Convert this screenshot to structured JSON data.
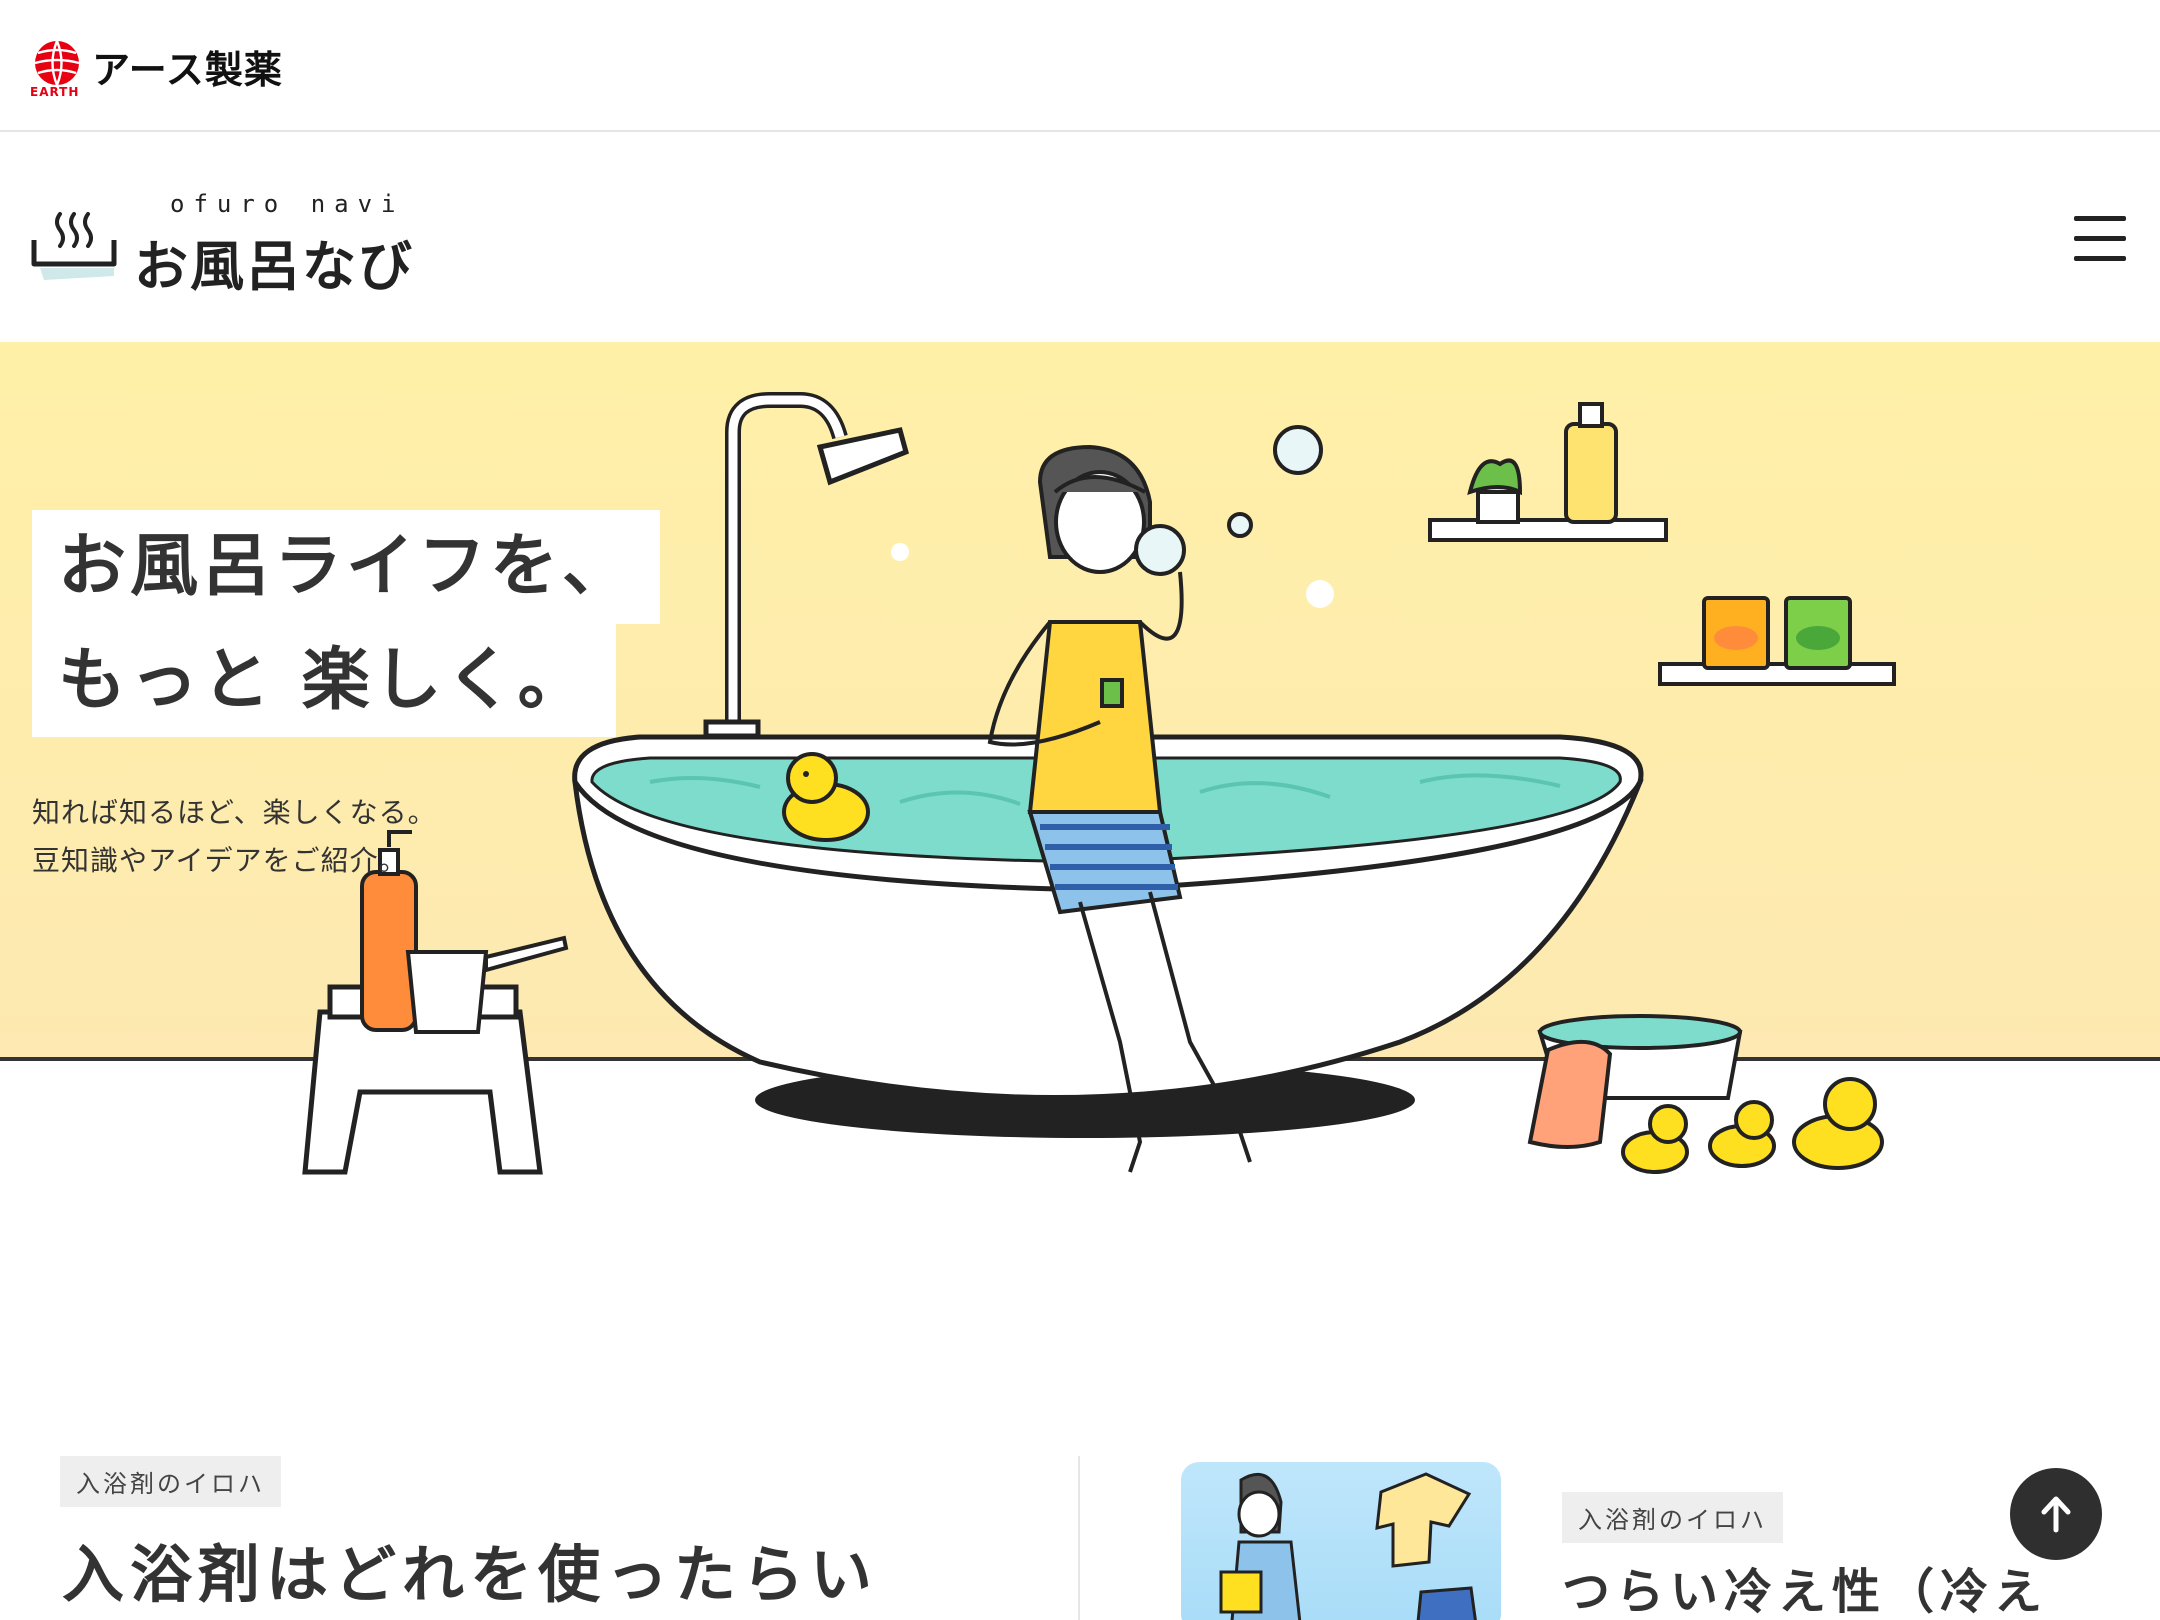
{
  "corporate": {
    "brand_name": "アース製薬",
    "brand_mark_text": "EARTH"
  },
  "site": {
    "logo_sub": "ofuro navi",
    "logo_main": "お風呂なび"
  },
  "hero": {
    "title_line1": "お風呂ライフを、",
    "title_line2": "もっと 楽しく。",
    "subtitle_line1": "知れば知るほど、楽しくなる。",
    "subtitle_line2": "豆知識やアイデアをご紹介。"
  },
  "articles": [
    {
      "tag": "入浴剤のイロハ",
      "title": "入浴剤はどれを使ったらい"
    },
    {
      "tag": "入浴剤のイロハ",
      "title": "つらい冷え性（冷え"
    }
  ],
  "colors": {
    "hero_bg_top": "#fff0a8",
    "water": "#7ddccb",
    "duck": "#ffe020",
    "tag_bg": "#eeeeee"
  },
  "icons": {
    "menu": "hamburger-icon",
    "to_top": "arrow-up-icon"
  }
}
